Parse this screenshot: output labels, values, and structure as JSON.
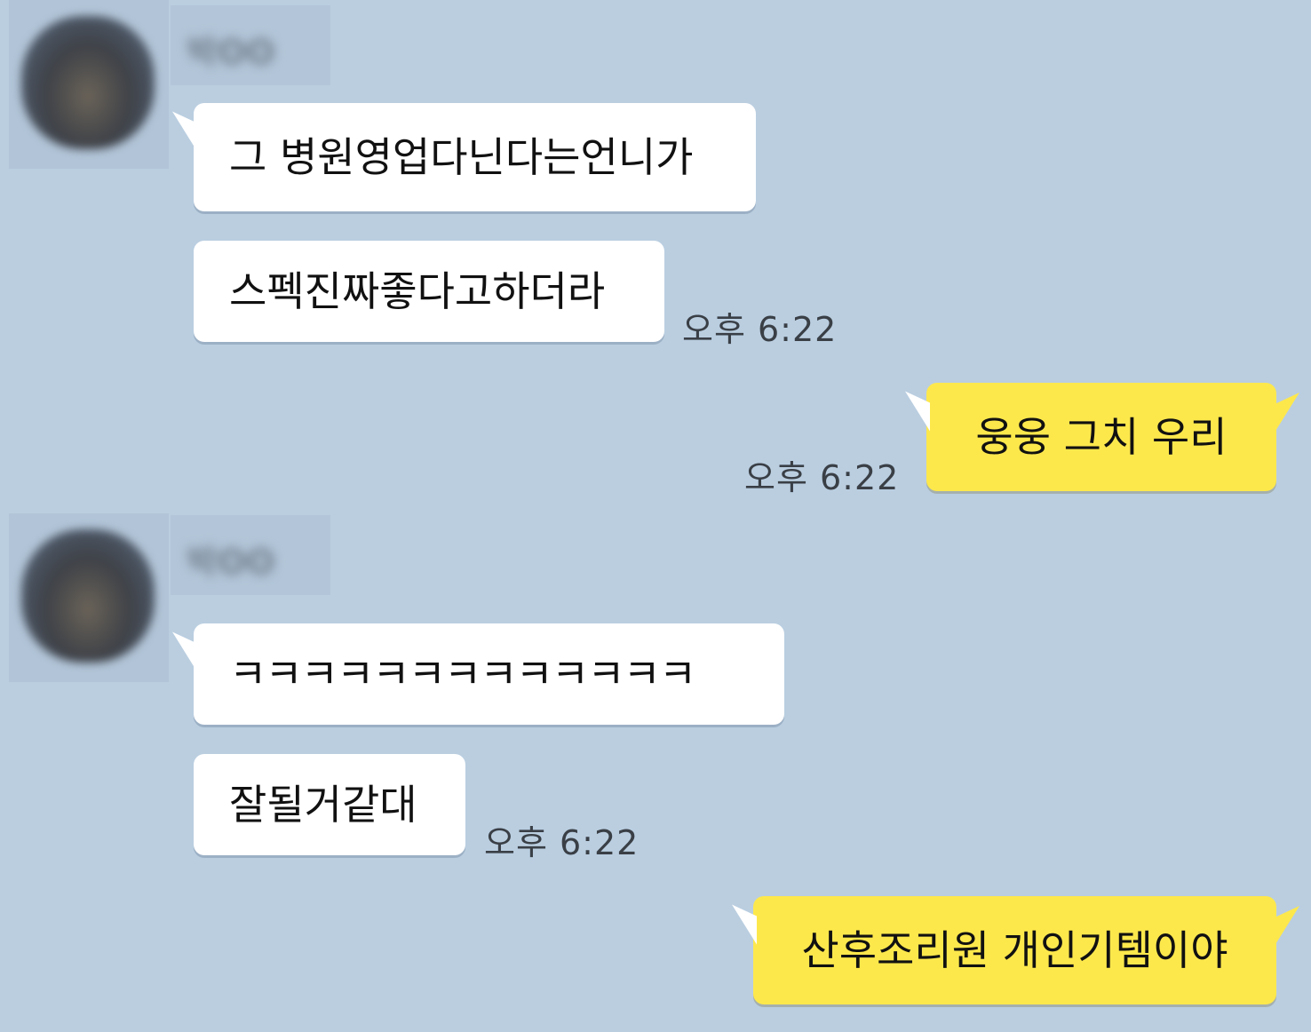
{
  "chat": {
    "groups": [
      {
        "sender_name": "박OO",
        "messages": [
          "그 병원영업다닌다는언니가",
          "스펙진짜좋다고하더라"
        ],
        "time": "오후 6:22"
      },
      {
        "sender_name": "박OO",
        "messages": [
          "ㅋㅋㅋㅋㅋㅋㅋㅋㅋㅋㅋㅋㅋ",
          "잘될거같대"
        ],
        "time": "오후 6:22"
      }
    ],
    "my_messages": [
      {
        "text": "웅웅 그치 우리",
        "time": "오후 6:22"
      },
      {
        "text": "산후조리원 개인기템이야"
      }
    ]
  },
  "colors": {
    "background": "#bacee0",
    "incoming_bubble": "#ffffff",
    "outgoing_bubble": "#fde84c"
  }
}
